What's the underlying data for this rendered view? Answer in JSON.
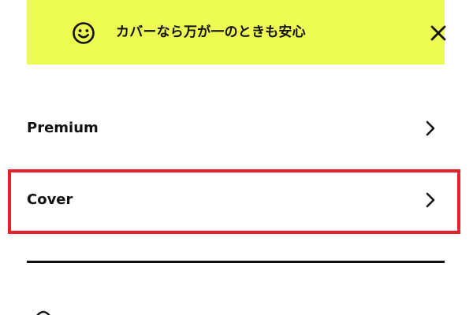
{
  "banner": {
    "icon": "smiley-face-icon",
    "message": "カバーなら万が一のときも安心",
    "close_icon": "close-icon",
    "background_color": "#eefb52"
  },
  "menu": {
    "items": [
      {
        "label": "Premium",
        "icon": "chevron-right-icon"
      },
      {
        "label": "Cover",
        "icon": "chevron-right-icon",
        "highlighted": true
      }
    ]
  },
  "highlight_color": "#e8202a"
}
